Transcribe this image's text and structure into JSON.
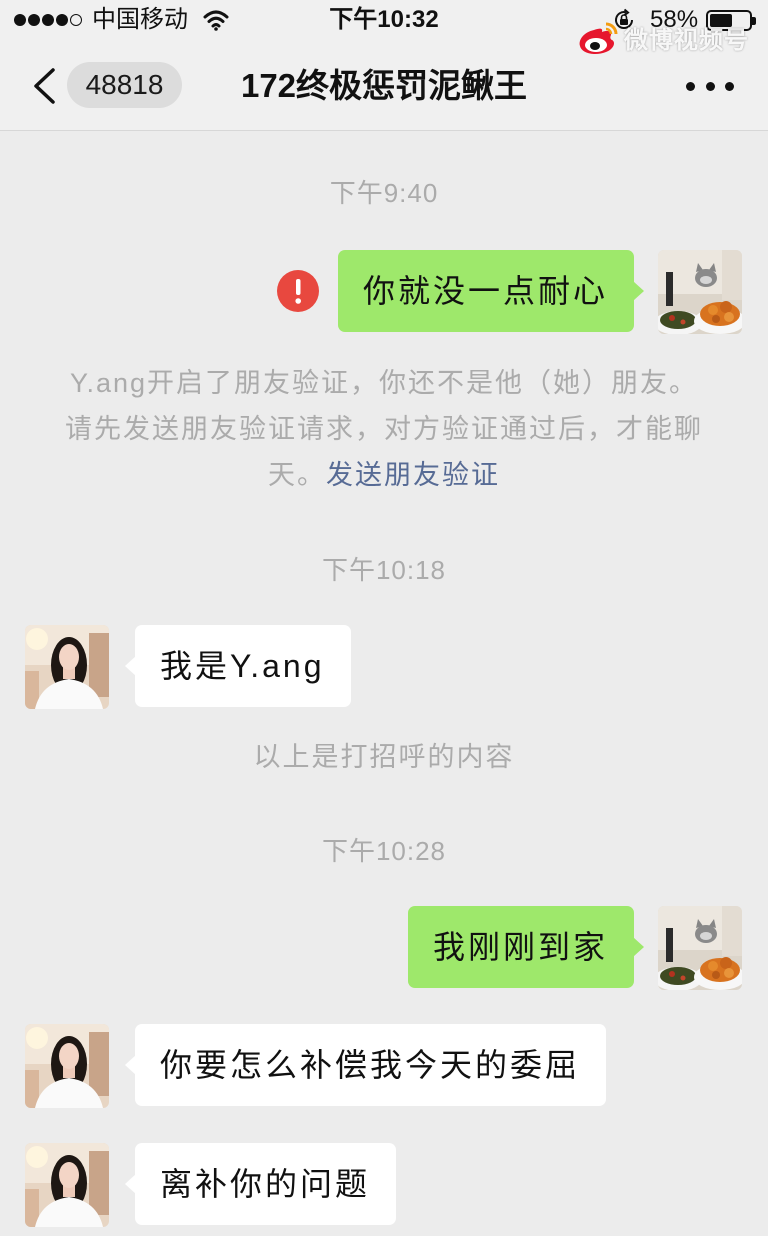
{
  "status_bar": {
    "signal_strength": 4,
    "signal_max": 5,
    "carrier": "中国移动",
    "time": "下午10:32",
    "battery_text": "58%",
    "battery_level": 0.58
  },
  "watermark": {
    "text": "微博视频号"
  },
  "nav": {
    "unread_count": "48818",
    "title": "172终极惩罚泥鳅王"
  },
  "chat": {
    "timestamps": [
      "下午9:40",
      "下午10:18",
      "下午10:28"
    ],
    "messages": [
      {
        "text": "你就没一点耐心",
        "from_me": true,
        "send_failed": true
      },
      {
        "text": "我是Y.ang",
        "from_me": false
      },
      {
        "text": "我刚刚到家",
        "from_me": true,
        "send_failed": false
      },
      {
        "text": "你要怎么补偿我今天的委屈",
        "from_me": false
      },
      {
        "text": "离补你的问题",
        "from_me": false
      }
    ],
    "friend_check_notice": {
      "line1": "Y.ang开启了朋友验证，你还不是他（她）朋友。",
      "line2": "请先发送朋友验证请求，对方验证通过后，才能聊天。",
      "link": "发送朋友验证"
    },
    "greeting_note": "以上是打招呼的内容"
  },
  "icons": {
    "back": "chevron-left-icon",
    "more": "more-dots-icon",
    "send_error": "error-icon",
    "wifi": "wifi-icon",
    "rotation_lock": "rotation-lock-icon",
    "watermark_logo": "weibo-logo-icon"
  },
  "colors": {
    "outgoing_bubble": "#9ee86b",
    "incoming_bubble": "#ffffff",
    "link": "#576b95",
    "error": "#e8483f",
    "meta_text": "#ababab"
  }
}
